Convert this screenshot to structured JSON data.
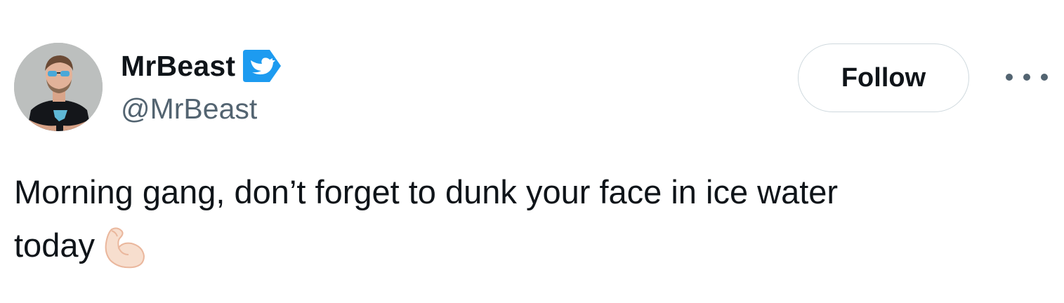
{
  "user": {
    "display_name": "MrBeast",
    "handle": "@MrBeast",
    "verified": true
  },
  "actions": {
    "follow_label": "Follow",
    "more_icon": "more-horizontal-icon"
  },
  "tweet": {
    "text_line1": "Morning gang, don’t forget to dunk your face in ice water",
    "text_line2": "today",
    "emoji": "flexed-biceps-icon"
  },
  "colors": {
    "text_primary": "#0f1419",
    "text_secondary": "#536471",
    "verified_blue": "#1d9bf0",
    "button_border": "#cfd9de",
    "background": "#ffffff"
  }
}
